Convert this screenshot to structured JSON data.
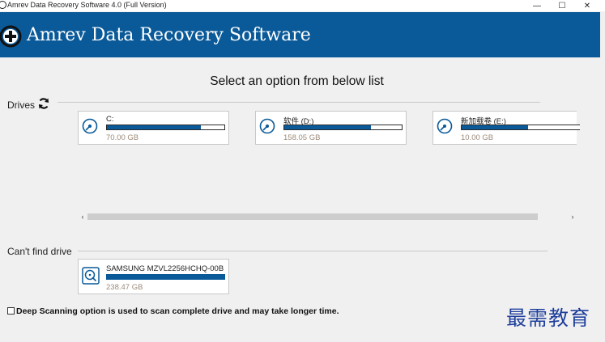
{
  "window": {
    "title": "Amrev Data Recovery Software 4.0 (Full Version)",
    "minimize_glyph": "—",
    "maximize_glyph": "☐",
    "close_glyph": "✕"
  },
  "banner": {
    "app_name": "Amrev Data Recovery Software"
  },
  "heading": "Select an option from below list",
  "drives_section": {
    "label": "Drives",
    "refresh_icon": "refresh-icon",
    "drives": [
      {
        "name": "C:",
        "size": "70.00 GB",
        "used_fraction": 0.8
      },
      {
        "name": "软件 (D:)",
        "size": "158.05 GB",
        "used_fraction": 0.74
      },
      {
        "name": "新加载卷 (E:)",
        "size": "10.00 GB",
        "used_fraction": 0.56
      }
    ],
    "scroll_left": "‹",
    "scroll_right": "›"
  },
  "cant_find_section": {
    "label": "Can't find drive",
    "physical_drive": {
      "name": "SAMSUNG MZVL2256HCHQ-00B",
      "size": "238.47 GB",
      "used_fraction": 1.0
    }
  },
  "deep_scan": {
    "checked": false,
    "label": "Deep Scanning option is used to scan complete drive and may take longer time."
  },
  "watermark": "最需教育",
  "colors": {
    "brand": "#0a5a99",
    "size_text": "#9b8a7a",
    "watermark": "#1f3f9c"
  }
}
